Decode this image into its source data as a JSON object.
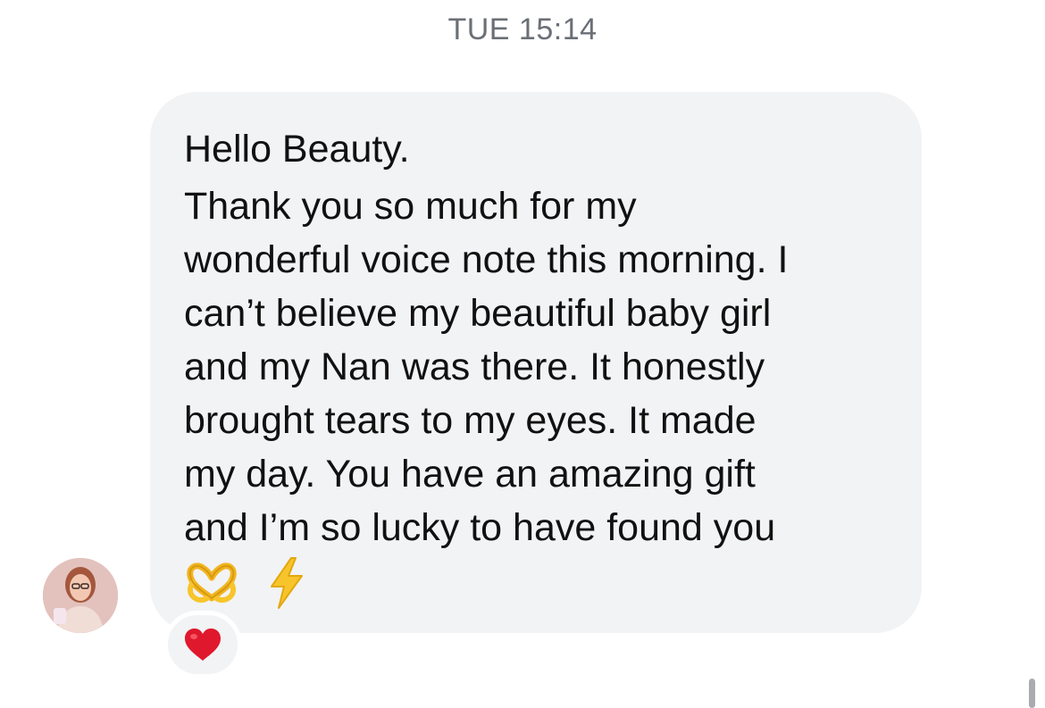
{
  "conversation": {
    "timestamp": "TUE 15:14",
    "message": {
      "greeting": "Hello Beauty.",
      "lines": [
        "Thank you so much for my",
        "wonderful voice note this morning. I",
        "can’t believe my beautiful baby girl",
        "and my Nan was there. It honestly",
        "brought tears to my eyes. It made",
        "my day. You have an amazing gift",
        "and I’m so lucky to have found you"
      ],
      "emojis": [
        "heart-hands-emoji",
        "high-voltage-emoji"
      ]
    },
    "reaction": {
      "icon": "red-heart-emoji"
    },
    "sender": {
      "avatar_icon": "avatar"
    }
  },
  "colors": {
    "bubble_background": "#f2f3f5",
    "text": "#111111",
    "timestamp": "#6b6f76",
    "reaction_heart": "#e0182d",
    "emoji_yellow": "#f7c52b"
  }
}
